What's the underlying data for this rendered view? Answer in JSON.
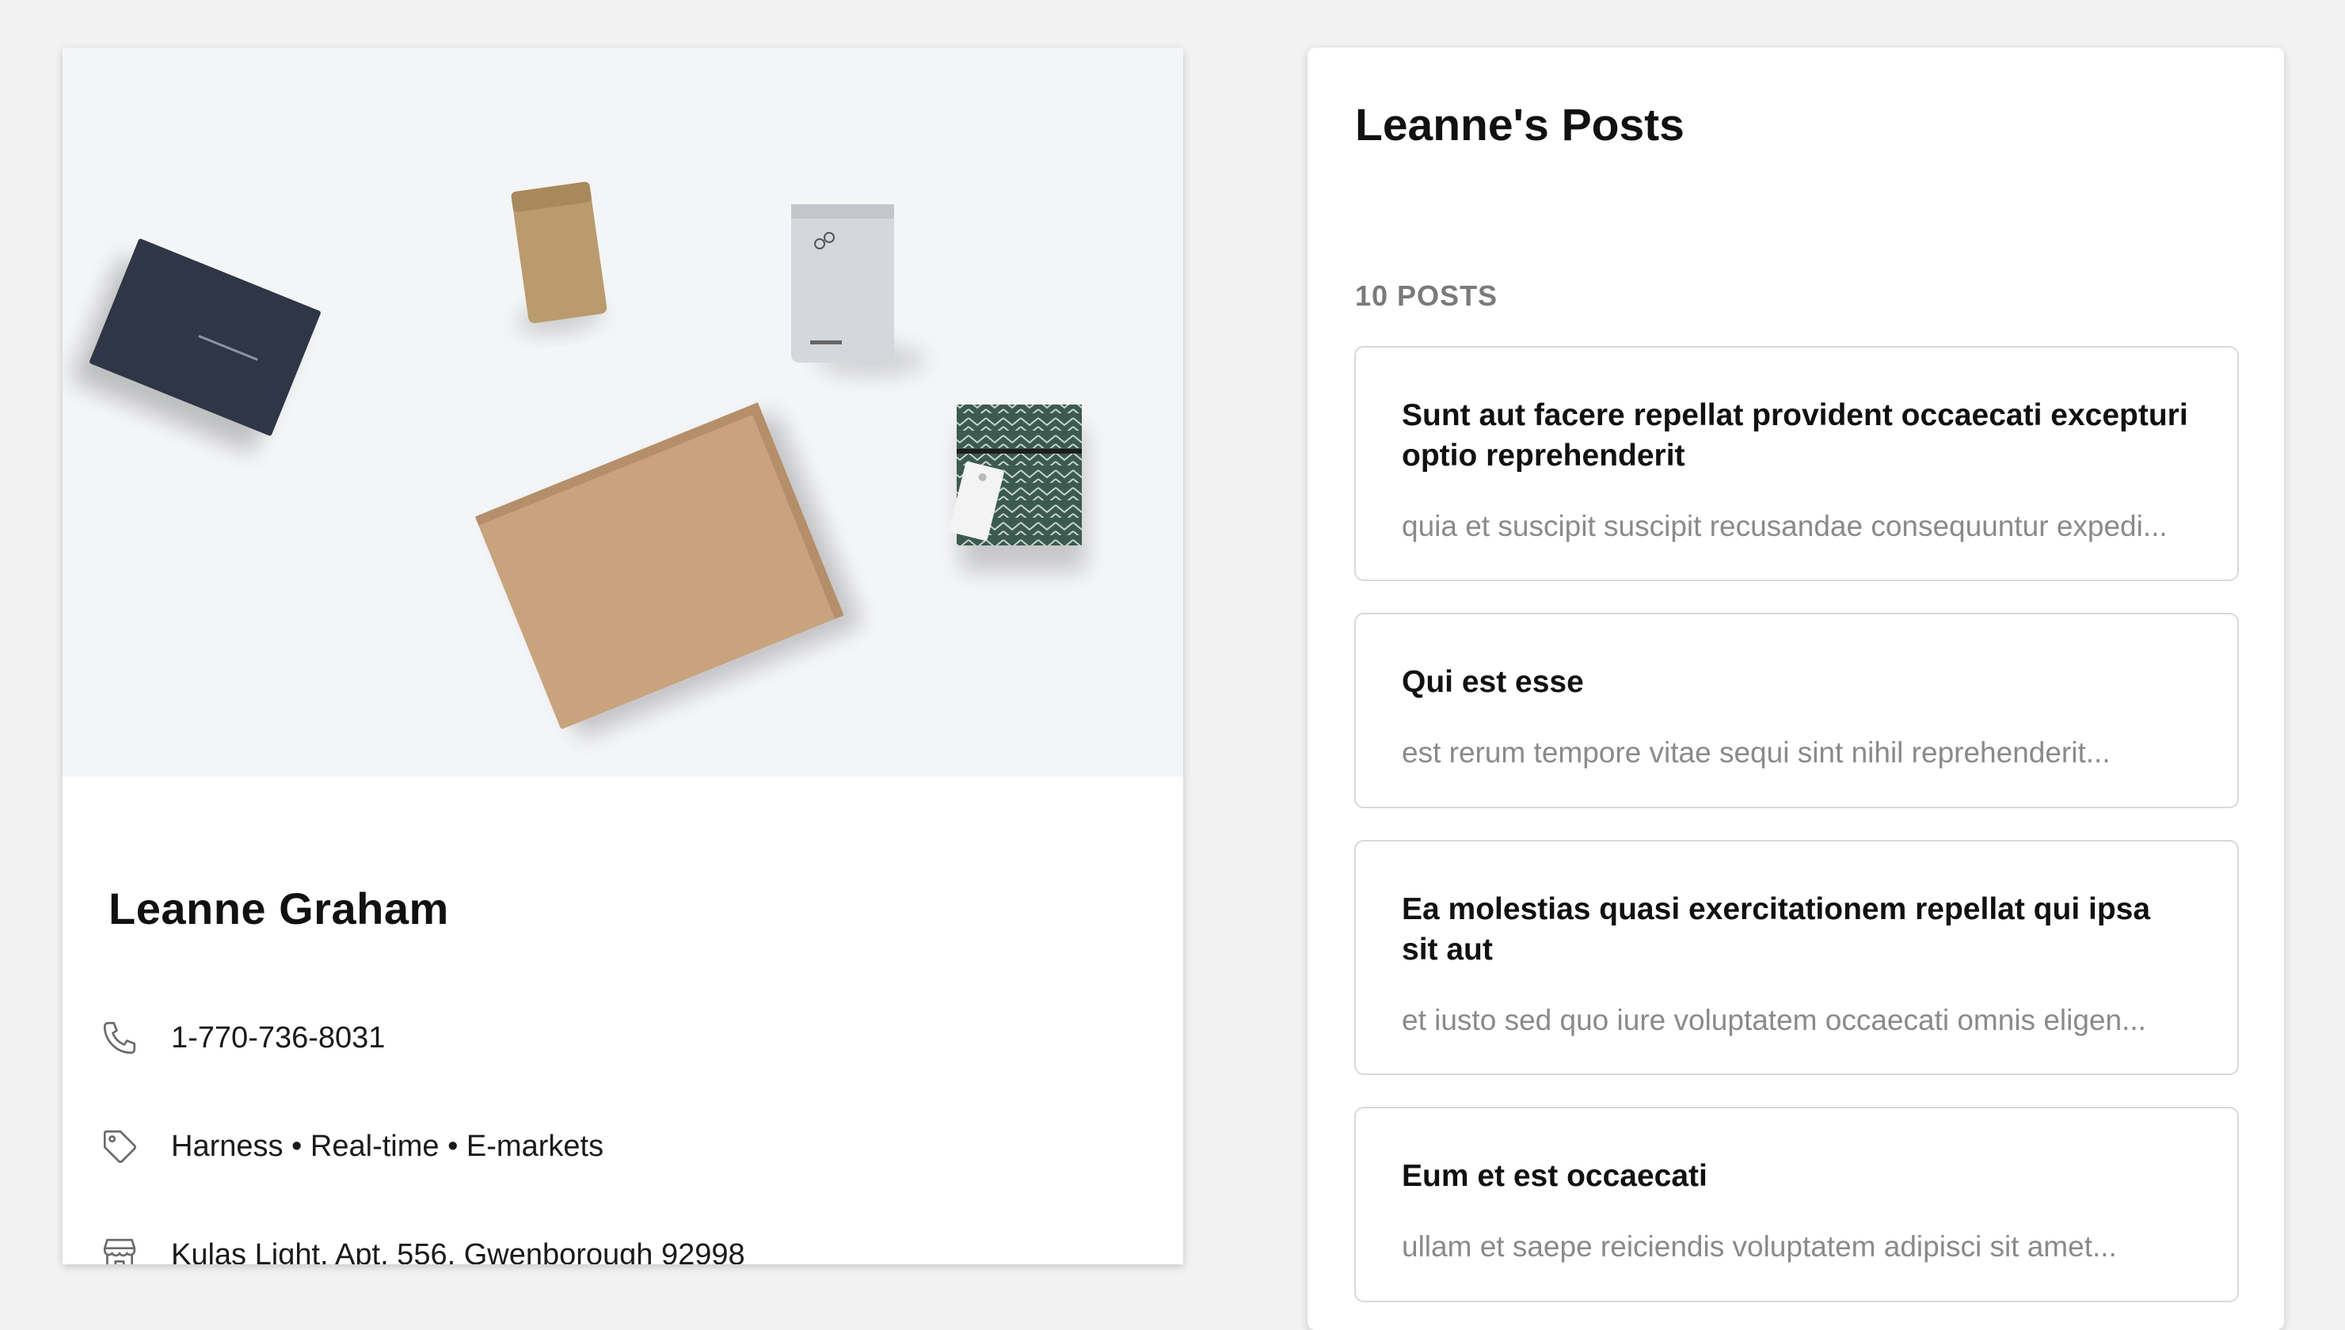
{
  "profile": {
    "name": "Leanne Graham",
    "phone": "1-770-736-8031",
    "tags": "Harness • Real-time • E-markets",
    "address": "Kulas Light, Apt. 556, Gwenborough 92998",
    "icons": {
      "phone": "phone-icon",
      "tags": "tag-icon",
      "address": "store-icon"
    }
  },
  "posts_panel": {
    "title": "Leanne's Posts",
    "count": "10 POSTS",
    "posts": [
      {
        "title": "Sunt aut facere repellat provident occaecati excepturi optio reprehenderit",
        "body": "quia et suscipit suscipit recusandae consequuntur expedi..."
      },
      {
        "title": "Qui est esse",
        "body": "est rerum tempore vitae sequi sint nihil reprehenderit..."
      },
      {
        "title": "Ea molestias quasi exercitationem repellat qui ipsa sit aut",
        "body": "et iusto sed quo iure voluptatem occaecati omnis eligen..."
      },
      {
        "title": "Eum et est occaecati",
        "body": "ullam et saepe reiciendis voluptatem adipisci sit amet..."
      }
    ]
  },
  "colors": {
    "background": "#f2f2f2",
    "card": "#ffffff",
    "muted_text": "#8a8a8a",
    "border": "#d9d9d9"
  }
}
